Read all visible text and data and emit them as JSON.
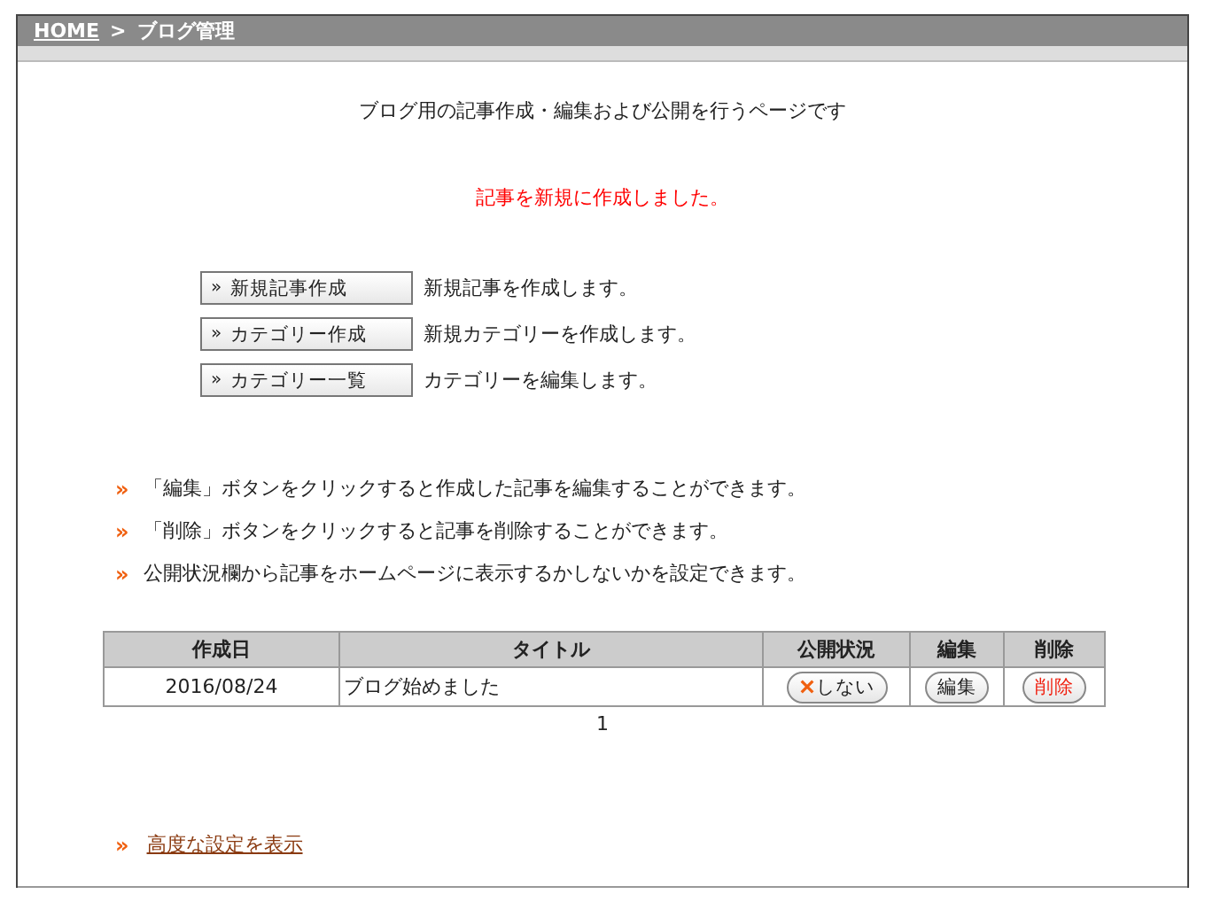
{
  "breadcrumb": {
    "home": "HOME",
    "separator": ">",
    "current": "ブログ管理"
  },
  "intro": "ブログ用の記事作成・編集および公開を行うページです",
  "message": "記事を新規に作成しました。",
  "actions": [
    {
      "marker": "»",
      "label": "新規記事作成",
      "description": "新規記事を作成します。"
    },
    {
      "marker": "»",
      "label": "カテゴリー作成",
      "description": "新規カテゴリーを作成します。"
    },
    {
      "marker": "»",
      "label": "カテゴリー一覧",
      "description": "カテゴリーを編集します。"
    }
  ],
  "notes": [
    {
      "marker": "»",
      "text": "「編集」ボタンをクリックすると作成した記事を編集することができます。"
    },
    {
      "marker": "»",
      "text": "「削除」ボタンをクリックすると記事を削除することができます。"
    },
    {
      "marker": "»",
      "text": "公開状況欄から記事をホームページに表示するかしないかを設定できます。"
    }
  ],
  "table": {
    "columns": [
      "作成日",
      "タイトル",
      "公開状況",
      "編集",
      "削除"
    ],
    "rows": [
      {
        "date": "2016/08/24",
        "title": "ブログ始めました",
        "published": false,
        "status": "しない",
        "edit": "編集",
        "delete": "削除"
      }
    ]
  },
  "pagination": [
    "1"
  ],
  "advanced_link": {
    "marker": "»",
    "label": "高度な設定を表示"
  }
}
